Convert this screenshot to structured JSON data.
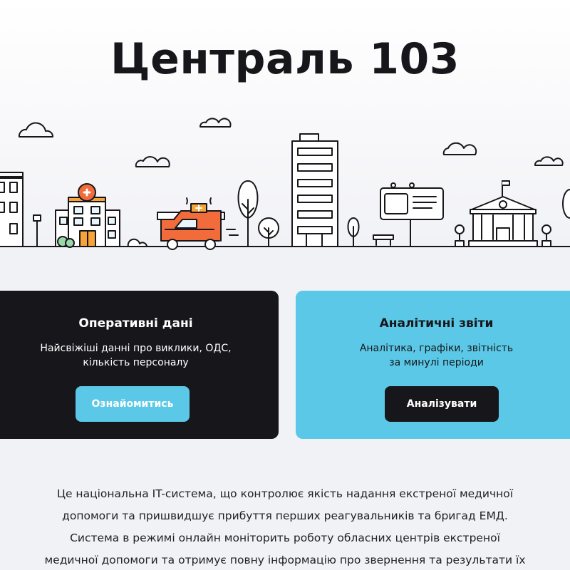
{
  "title": "Централь 103",
  "cards": {
    "operational": {
      "title": "Оперативні дані",
      "desc_line1": "Найсвіжіші данні про виклики, ОДС,",
      "desc_line2": "кількість персоналу",
      "button": "Ознайомитись"
    },
    "analytics": {
      "title": "Аналітичні звіти",
      "desc_line1": "Аналітика, графіки, звітність",
      "desc_line2": "за минулі періоди",
      "button": "Аналізувати"
    }
  },
  "about": {
    "line1": "Це національна IT-система, що контролює якість надання екстреної медичної",
    "line2": "допомоги та пришвидшує прибуття перших реагувальників та бригад ЕМД.",
    "line3": "Система в режимі онлайн моніторить роботу обласних центрів екстреної",
    "line4": "медичної допомоги та отримує повну інформацію про звернення та результати їх"
  },
  "colors": {
    "dark": "#17171b",
    "accent_blue": "#5ac8e6",
    "ambulance_orange": "#f26b3a",
    "background": "#f1f2f6"
  }
}
